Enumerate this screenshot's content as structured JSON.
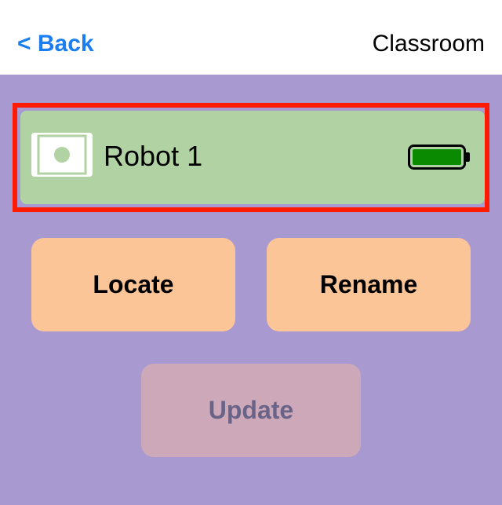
{
  "header": {
    "back_label": "< Back",
    "title": "Classroom"
  },
  "robot": {
    "name": "Robot 1",
    "battery_level": 1.0,
    "icon": "robot-icon"
  },
  "actions": {
    "locate_label": "Locate",
    "rename_label": "Rename",
    "update_label": "Update"
  },
  "colors": {
    "background": "#a89ad0",
    "header": "#ffffff",
    "back_link": "#1a7ef0",
    "robot_card": "#b1d2a3",
    "selection_border": "#ff1a00",
    "action_button": "#fbc597",
    "update_button_disabled": "#cda8b9",
    "update_text_disabled": "#6a6388",
    "battery_fill": "#0a8a00"
  }
}
